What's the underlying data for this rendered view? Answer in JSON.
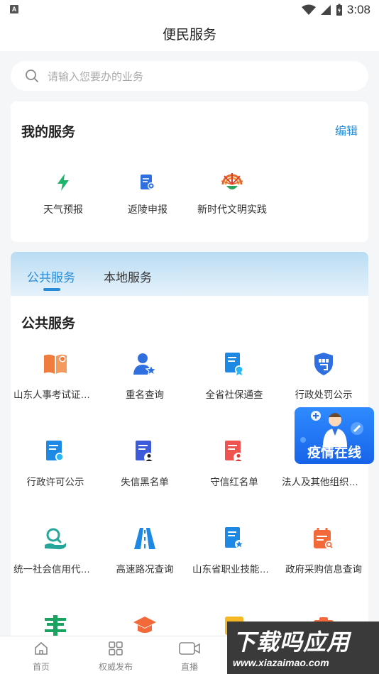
{
  "status_bar": {
    "time": "3:08",
    "notif_badge": "A"
  },
  "header": {
    "title": "便民服务"
  },
  "search": {
    "placeholder": "请输入您要办的业务"
  },
  "my_services": {
    "title": "我的服务",
    "edit_label": "编辑",
    "items": [
      {
        "label": "天气预报",
        "icon": "lightning-icon"
      },
      {
        "label": "返陵申报",
        "icon": "declaration-doc-icon"
      },
      {
        "label": "新时代文明实践",
        "icon": "civilization-emblem-icon"
      }
    ]
  },
  "tabs": [
    {
      "label": "公共服务",
      "active": true
    },
    {
      "label": "本地服务",
      "active": false
    }
  ],
  "public_services": {
    "title": "公共服务",
    "items": [
      {
        "label": "山东人事考试证书查询",
        "icon": "book-certificate-icon"
      },
      {
        "label": "重名查询",
        "icon": "user-star-icon"
      },
      {
        "label": "全省社保通查",
        "icon": "doc-badge-icon"
      },
      {
        "label": "行政处罚公示",
        "icon": "shield-penalty-icon"
      },
      {
        "label": "行政许可公示",
        "icon": "permit-doc-icon"
      },
      {
        "label": "失信黑名单",
        "icon": "blacklist-doc-icon"
      },
      {
        "label": "守信红名单",
        "icon": "redlist-doc-icon"
      },
      {
        "label": "法人及其他组织信息查询",
        "icon": "org-info-icon"
      },
      {
        "label": "统一社会信用代码查询",
        "icon": "search-hand-icon"
      },
      {
        "label": "高速路况查询",
        "icon": "highway-icon"
      },
      {
        "label": "山东省职业技能证书查询",
        "icon": "skill-cert-icon"
      },
      {
        "label": "政府采购信息查询",
        "icon": "procurement-calendar-icon"
      },
      {
        "label": "",
        "icon": "railway-icon"
      },
      {
        "label": "",
        "icon": "graduation-cap-icon"
      },
      {
        "label": "",
        "icon": "recruit-icon"
      },
      {
        "label": "",
        "icon": "camera-icon"
      }
    ]
  },
  "floating_banner": {
    "label": "疫情在线"
  },
  "bottom_nav": [
    {
      "label": "首页",
      "icon": "home-icon"
    },
    {
      "label": "权威发布",
      "icon": "grid-icon"
    },
    {
      "label": "直播",
      "icon": "video-icon"
    }
  ],
  "watermark": {
    "line1": "下载吗应用",
    "line2": "www.xiazaimao.com"
  },
  "colors": {
    "accent": "#2a8cd6",
    "tab_bg_top": "#b9dcf3",
    "banner_blue": "#1763e8"
  }
}
